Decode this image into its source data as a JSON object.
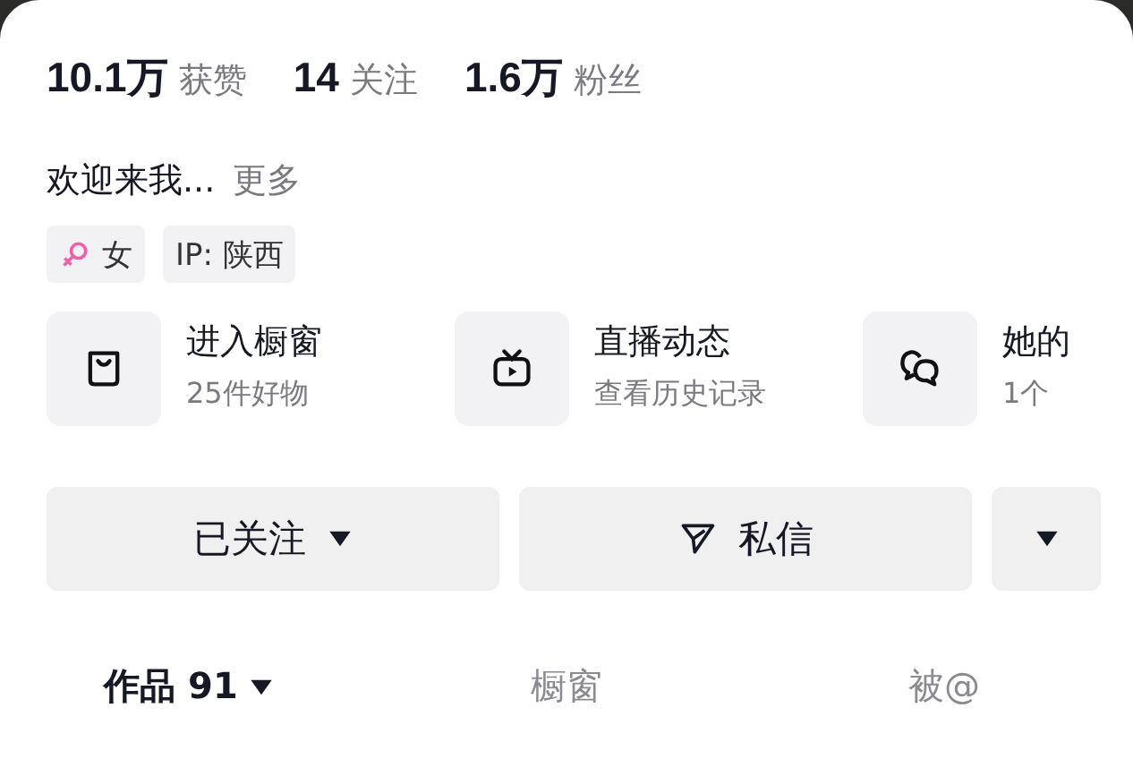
{
  "stats": [
    "**10.1万** 获赞",
    "**14** 关注",
    "**1.6万** 粉丝"
  ],
  "bio": {
    "text": "欢迎来我...",
    "more": "更多"
  },
  "tags": [
    {
      "kind": "gender",
      "text": "女"
    },
    {
      "kind": "plain",
      "text": "IP: 陕西"
    }
  ],
  "shortcuts": [
    {
      "kind": "bag",
      "title": "进入橱窗",
      "subtitle": "25件好物"
    },
    {
      "kind": "tv",
      "title": "直播动态",
      "subtitle": "查看历史记录"
    },
    {
      "kind": "chat",
      "title": "她的",
      "subtitle": "1个"
    }
  ],
  "actions": [
    {
      "kind": "follow",
      "label": "已关注"
    },
    {
      "kind": "message",
      "label": "私信"
    },
    {
      "kind": "more"
    }
  ],
  "tabs": [
    {
      "label": "作品 91",
      "selected": true,
      "dropdown": true
    },
    {
      "label": "橱窗",
      "selected": false,
      "dropdown": false
    },
    {
      "label": "被@",
      "selected": false,
      "dropdown": false
    }
  ]
}
